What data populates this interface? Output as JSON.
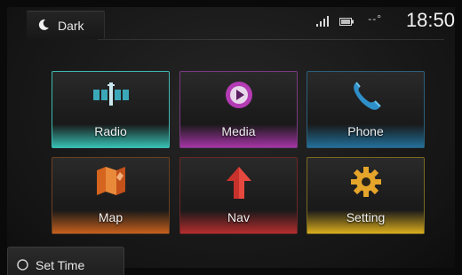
{
  "topbar": {
    "theme_toggle": {
      "label": "Dark",
      "icon": "moon-icon"
    },
    "status": {
      "signal_icon": "signal-bars-icon",
      "battery_icon": "battery-icon",
      "temperature": "--°",
      "time": "18:50"
    }
  },
  "tiles": [
    {
      "label": "Radio",
      "icon": "radio-icon",
      "accent": "#3cdccd"
    },
    {
      "label": "Media",
      "icon": "media-play-icon",
      "accent": "#c83cc8"
    },
    {
      "label": "Phone",
      "icon": "phone-icon",
      "accent": "#2896d2"
    },
    {
      "label": "Map",
      "icon": "map-icon",
      "accent": "#e66e1e"
    },
    {
      "label": "Nav",
      "icon": "nav-arrow-icon",
      "accent": "#d23232"
    },
    {
      "label": "Setting",
      "icon": "gear-icon",
      "accent": "#f0be1e"
    }
  ],
  "bottom": {
    "set_time_label": "Set Time",
    "set_time_icon": "clock-ring-icon"
  }
}
